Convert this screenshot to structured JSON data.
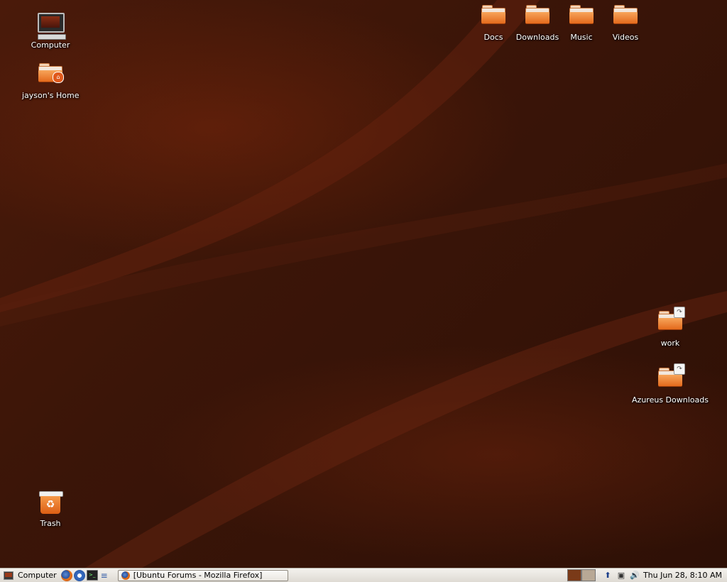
{
  "desktop": {
    "icons": {
      "computer": "Computer",
      "home": "jayson's Home",
      "docs": "Docs",
      "downloads": "Downloads",
      "music": "Music",
      "videos": "Videos",
      "work": "work",
      "azureus": "Azureus Downloads",
      "trash": "Trash"
    }
  },
  "panel": {
    "menu_label": "Computer",
    "launchers": [
      "firefox-icon",
      "evolution-icon",
      "terminal-icon",
      "menu-icon"
    ],
    "task_title": "[Ubuntu Forums - Mozilla Firefox]",
    "clock": "Thu Jun 28,  8:10 AM",
    "tray": [
      "update-icon",
      "network-icon",
      "volume-icon"
    ]
  },
  "colors": {
    "wallpaper": "#3a1608",
    "folder_orange": "#e46a1c",
    "panel_bg": "#dedad3"
  }
}
